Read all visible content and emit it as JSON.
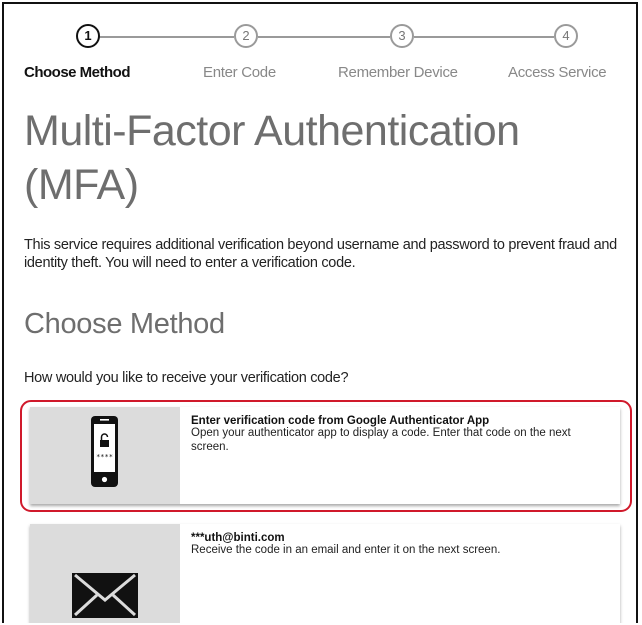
{
  "stepper": {
    "steps": [
      {
        "number": "1",
        "label": "Choose Method",
        "active": true
      },
      {
        "number": "2",
        "label": "Enter Code",
        "active": false
      },
      {
        "number": "3",
        "label": "Remember Device",
        "active": false
      },
      {
        "number": "4",
        "label": "Access Service",
        "active": false
      }
    ]
  },
  "page": {
    "title_line1": "Multi-Factor Authentication",
    "title_line2": "(MFA)",
    "intro": "This service requires additional verification beyond username and password to prevent fraud and identity theft. You will need to enter a verification code.",
    "section_title": "Choose Method",
    "question": "How would you like to receive your verification code?"
  },
  "methods": [
    {
      "icon": "phone-lock-icon",
      "title": "Enter verification code from Google Authenticator App",
      "description": "Open your authenticator app to display a code. Enter that code on the next screen.",
      "selected": true
    },
    {
      "icon": "envelope-icon",
      "title": "***uth@binti.com",
      "description": "Receive the code in an email and enter it on the next screen.",
      "selected": false
    }
  ],
  "colors": {
    "highlight": "#d0192b",
    "heading": "#6e6e6e",
    "icon_panel": "#dcdcdc",
    "step_inactive": "#9a9a9a"
  }
}
